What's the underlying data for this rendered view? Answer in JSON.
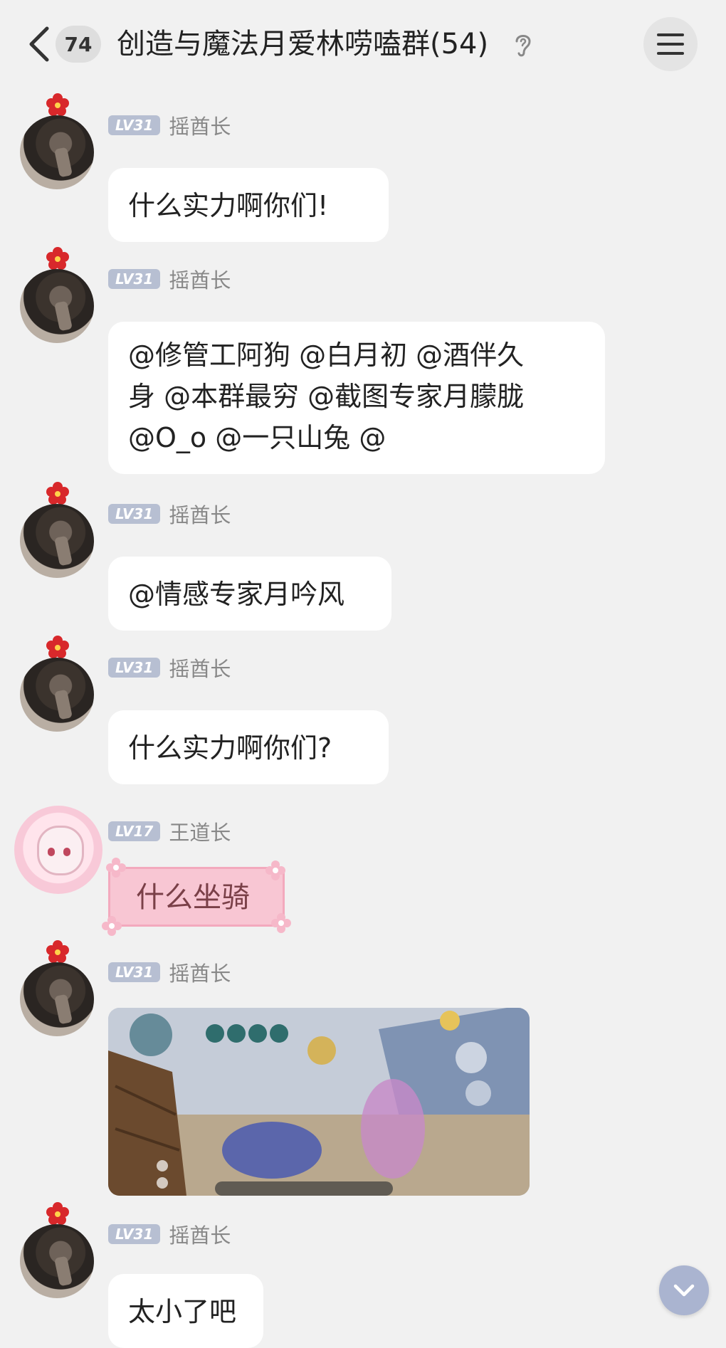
{
  "header": {
    "unread_count": "74",
    "title": "创造与魔法月爱林唠嗑群(54)",
    "back_icon": "chevron-left-icon",
    "ear_icon": "ear-icon",
    "menu_icon": "hamburger-menu-icon"
  },
  "messages": [
    {
      "level": "LV31",
      "sender": "摇酋长",
      "text": "什么实力啊你们!"
    },
    {
      "level": "LV31",
      "sender": "摇酋长",
      "text_lines": [
        "@修管工阿狗 @白月初 @酒伴久",
        "身 @本群最穷 @截图专家月朦胧",
        "@O_o @一只山兔 @"
      ]
    },
    {
      "level": "LV31",
      "sender": "摇酋长",
      "text": "@情感专家月吟风"
    },
    {
      "level": "LV31",
      "sender": "摇酋长",
      "text": "什么实力啊你们?"
    },
    {
      "level": "LV17",
      "sender": "王道长",
      "text": "什么坐骑"
    },
    {
      "level": "LV31",
      "sender": "摇酋长",
      "image": "game-screenshot"
    },
    {
      "level": "LV31",
      "sender": "摇酋长",
      "text": "太小了吧"
    }
  ],
  "colors": {
    "background": "#f1f1f1",
    "bubble": "#ffffff",
    "pink_bubble": "#f8c6d3",
    "level_badge": "#b7bfd2",
    "scroll_button": "#aab4d0"
  }
}
